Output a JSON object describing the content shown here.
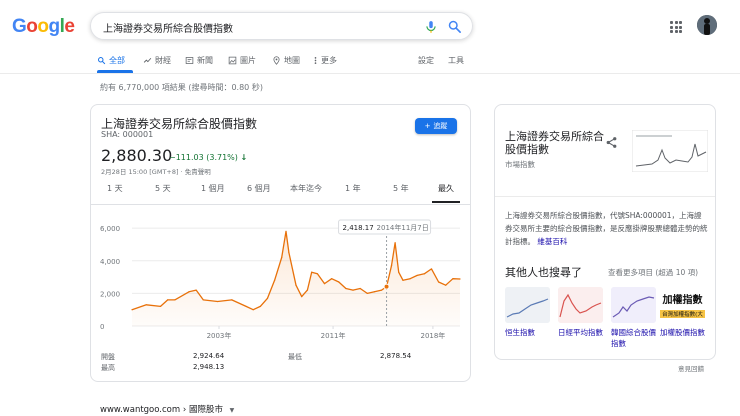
{
  "logo": "Google",
  "search": {
    "query": "上海證券交易所綜合股價指數"
  },
  "tabs": [
    {
      "label": "全部",
      "icon": "search-icon",
      "active": true
    },
    {
      "label": "財經",
      "icon": "finance-icon"
    },
    {
      "label": "新聞",
      "icon": "news-icon"
    },
    {
      "label": "圖片",
      "icon": "image-icon"
    },
    {
      "label": "地圖",
      "icon": "map-pin-icon"
    },
    {
      "label": "更多",
      "icon": "more-vert-icon"
    }
  ],
  "tools": {
    "settings": "設定",
    "tools": "工具"
  },
  "results_stats": "約有 6,770,000 項結果 (搜尋時間：0.80 秒)",
  "finance": {
    "name": "上海證券交易所綜合股價指數",
    "symbol": "SHA: 000001",
    "follow_label": "追蹤",
    "price": "2,880.30",
    "change": "−111.03 (3.71%)",
    "change_color": "#137333",
    "as_of": "2月28日 15:00 [GMT+8] · 免責聲明",
    "ranges": [
      "1 天",
      "5 天",
      "1 個月",
      "6 個月",
      "本年迄今",
      "1 年",
      "5 年",
      "最久"
    ],
    "active_range": "最久",
    "tooltip": {
      "value": "2,418.17",
      "date": "2014年11月7日"
    },
    "stats": [
      {
        "label": "開盤",
        "value": "2,924.64"
      },
      {
        "label": "最高",
        "value": "2,948.13"
      },
      {
        "label": "最低",
        "value": "2,878.54"
      }
    ]
  },
  "chart_data": {
    "type": "area",
    "color": "#e8710a",
    "ylim": [
      0,
      6500
    ],
    "yticks": [
      "0",
      "2,000",
      "4,000",
      "6,000"
    ],
    "xticks": [
      "2003年",
      "2011年",
      "2018年"
    ],
    "x": [
      1997.0,
      1998.0,
      1999.0,
      1999.5,
      2000.0,
      2001.0,
      2001.5,
      2002.0,
      2003.0,
      2004.0,
      2005.0,
      2005.5,
      2006.0,
      2006.5,
      2007.0,
      2007.5,
      2007.8,
      2008.0,
      2008.5,
      2008.9,
      2009.3,
      2009.6,
      2010.0,
      2010.5,
      2011.0,
      2011.5,
      2012.0,
      2012.5,
      2013.0,
      2013.5,
      2014.0,
      2014.5,
      2014.85,
      2015.2,
      2015.45,
      2015.7,
      2016.0,
      2016.5,
      2017.0,
      2017.5,
      2018.0,
      2018.5,
      2019.0,
      2019.5,
      2020.0
    ],
    "y": [
      1000,
      1300,
      1200,
      1600,
      1600,
      2100,
      2200,
      1600,
      1500,
      1600,
      1200,
      1000,
      1200,
      1700,
      2800,
      4200,
      5800,
      4500,
      2500,
      1800,
      2200,
      3300,
      3200,
      2600,
      2900,
      2700,
      2300,
      2200,
      2300,
      2000,
      2100,
      2200,
      2418,
      3700,
      5100,
      3300,
      2800,
      2900,
      3100,
      3200,
      3500,
      2700,
      2500,
      2900,
      2880
    ]
  },
  "knowledge_panel": {
    "title": "上海證券交易所綜合股價指數",
    "subtitle": "市場指數",
    "description": "上海證券交易所綜合股價指數，代號SHA:000001，上海證券交易所主要的綜合股價指數，是反應掛牌股票總體走勢的統計指標。",
    "source": "維基百科",
    "also_searched": "其他人也搜尋了",
    "see_more": "查看更多項目 (超過 10 項)",
    "related": [
      {
        "label": "恒生指數"
      },
      {
        "label": "日經平均指數"
      },
      {
        "label": "韓國綜合股價指數"
      },
      {
        "label": "加權股價指數",
        "logo_text": "加權指數",
        "logo_sub": "台灣加權指數(大"
      }
    ],
    "feedback": "意見回饋"
  },
  "source_link": "www.wantgoo.com › 國際股市"
}
